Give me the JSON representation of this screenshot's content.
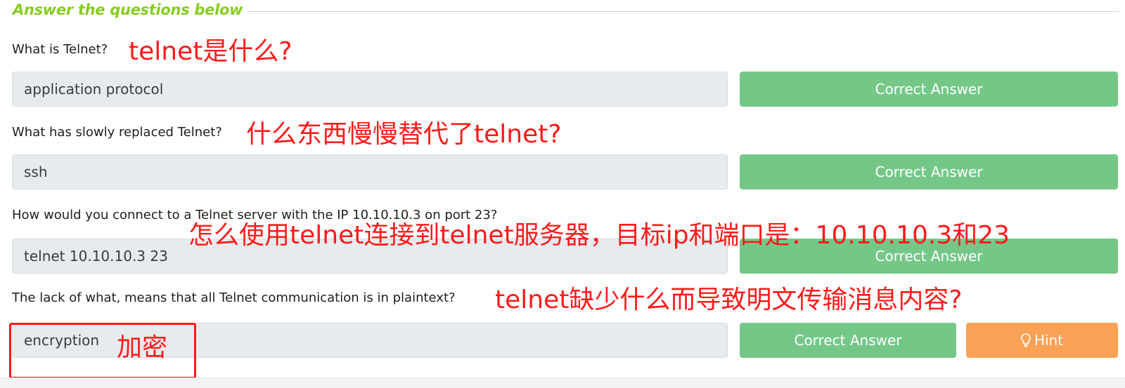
{
  "section": {
    "title": "Answer the questions below"
  },
  "questions": [
    {
      "text": "What is Telnet?",
      "answer": "application protocol",
      "button": "Correct Answer",
      "note": "telnet是什么?"
    },
    {
      "text": "What has slowly replaced Telnet?",
      "answer": "ssh",
      "button": "Correct Answer",
      "note": "什么东西慢慢替代了telnet?"
    },
    {
      "text": "How would you connect to a Telnet server with the IP 10.10.10.3 on port 23?",
      "answer": "telnet 10.10.10.3 23",
      "button": "Correct Answer",
      "note": "怎么使用telnet连接到telnet服务器，目标ip和端口是：10.10.10.3和23"
    },
    {
      "text": "The lack of what, means that all Telnet communication is in plaintext?",
      "answer": "encryption",
      "button": "Correct Answer",
      "hint": "Hint",
      "note": "telnet缺少什么而导致明文传输消息内容?",
      "answer_note": "加密"
    }
  ],
  "colors": {
    "accent": "#88cc22",
    "correct": "#75c788",
    "hint": "#f9a155",
    "annotation": "#ff1a1a"
  }
}
